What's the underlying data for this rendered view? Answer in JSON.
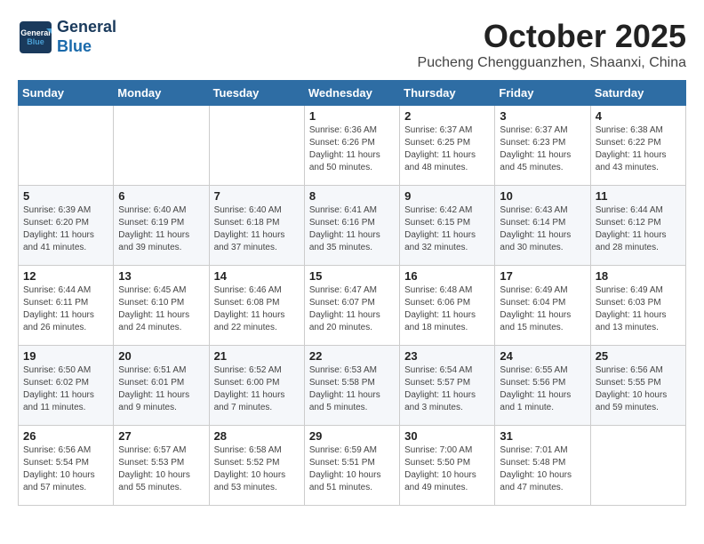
{
  "header": {
    "logo_line1": "General",
    "logo_line2": "Blue",
    "month": "October 2025",
    "location": "Pucheng Chengguanzhen, Shaanxi, China"
  },
  "days_of_week": [
    "Sunday",
    "Monday",
    "Tuesday",
    "Wednesday",
    "Thursday",
    "Friday",
    "Saturday"
  ],
  "weeks": [
    [
      {
        "day": "",
        "info": ""
      },
      {
        "day": "",
        "info": ""
      },
      {
        "day": "",
        "info": ""
      },
      {
        "day": "1",
        "info": "Sunrise: 6:36 AM\nSunset: 6:26 PM\nDaylight: 11 hours\nand 50 minutes."
      },
      {
        "day": "2",
        "info": "Sunrise: 6:37 AM\nSunset: 6:25 PM\nDaylight: 11 hours\nand 48 minutes."
      },
      {
        "day": "3",
        "info": "Sunrise: 6:37 AM\nSunset: 6:23 PM\nDaylight: 11 hours\nand 45 minutes."
      },
      {
        "day": "4",
        "info": "Sunrise: 6:38 AM\nSunset: 6:22 PM\nDaylight: 11 hours\nand 43 minutes."
      }
    ],
    [
      {
        "day": "5",
        "info": "Sunrise: 6:39 AM\nSunset: 6:20 PM\nDaylight: 11 hours\nand 41 minutes."
      },
      {
        "day": "6",
        "info": "Sunrise: 6:40 AM\nSunset: 6:19 PM\nDaylight: 11 hours\nand 39 minutes."
      },
      {
        "day": "7",
        "info": "Sunrise: 6:40 AM\nSunset: 6:18 PM\nDaylight: 11 hours\nand 37 minutes."
      },
      {
        "day": "8",
        "info": "Sunrise: 6:41 AM\nSunset: 6:16 PM\nDaylight: 11 hours\nand 35 minutes."
      },
      {
        "day": "9",
        "info": "Sunrise: 6:42 AM\nSunset: 6:15 PM\nDaylight: 11 hours\nand 32 minutes."
      },
      {
        "day": "10",
        "info": "Sunrise: 6:43 AM\nSunset: 6:14 PM\nDaylight: 11 hours\nand 30 minutes."
      },
      {
        "day": "11",
        "info": "Sunrise: 6:44 AM\nSunset: 6:12 PM\nDaylight: 11 hours\nand 28 minutes."
      }
    ],
    [
      {
        "day": "12",
        "info": "Sunrise: 6:44 AM\nSunset: 6:11 PM\nDaylight: 11 hours\nand 26 minutes."
      },
      {
        "day": "13",
        "info": "Sunrise: 6:45 AM\nSunset: 6:10 PM\nDaylight: 11 hours\nand 24 minutes."
      },
      {
        "day": "14",
        "info": "Sunrise: 6:46 AM\nSunset: 6:08 PM\nDaylight: 11 hours\nand 22 minutes."
      },
      {
        "day": "15",
        "info": "Sunrise: 6:47 AM\nSunset: 6:07 PM\nDaylight: 11 hours\nand 20 minutes."
      },
      {
        "day": "16",
        "info": "Sunrise: 6:48 AM\nSunset: 6:06 PM\nDaylight: 11 hours\nand 18 minutes."
      },
      {
        "day": "17",
        "info": "Sunrise: 6:49 AM\nSunset: 6:04 PM\nDaylight: 11 hours\nand 15 minutes."
      },
      {
        "day": "18",
        "info": "Sunrise: 6:49 AM\nSunset: 6:03 PM\nDaylight: 11 hours\nand 13 minutes."
      }
    ],
    [
      {
        "day": "19",
        "info": "Sunrise: 6:50 AM\nSunset: 6:02 PM\nDaylight: 11 hours\nand 11 minutes."
      },
      {
        "day": "20",
        "info": "Sunrise: 6:51 AM\nSunset: 6:01 PM\nDaylight: 11 hours\nand 9 minutes."
      },
      {
        "day": "21",
        "info": "Sunrise: 6:52 AM\nSunset: 6:00 PM\nDaylight: 11 hours\nand 7 minutes."
      },
      {
        "day": "22",
        "info": "Sunrise: 6:53 AM\nSunset: 5:58 PM\nDaylight: 11 hours\nand 5 minutes."
      },
      {
        "day": "23",
        "info": "Sunrise: 6:54 AM\nSunset: 5:57 PM\nDaylight: 11 hours\nand 3 minutes."
      },
      {
        "day": "24",
        "info": "Sunrise: 6:55 AM\nSunset: 5:56 PM\nDaylight: 11 hours\nand 1 minute."
      },
      {
        "day": "25",
        "info": "Sunrise: 6:56 AM\nSunset: 5:55 PM\nDaylight: 10 hours\nand 59 minutes."
      }
    ],
    [
      {
        "day": "26",
        "info": "Sunrise: 6:56 AM\nSunset: 5:54 PM\nDaylight: 10 hours\nand 57 minutes."
      },
      {
        "day": "27",
        "info": "Sunrise: 6:57 AM\nSunset: 5:53 PM\nDaylight: 10 hours\nand 55 minutes."
      },
      {
        "day": "28",
        "info": "Sunrise: 6:58 AM\nSunset: 5:52 PM\nDaylight: 10 hours\nand 53 minutes."
      },
      {
        "day": "29",
        "info": "Sunrise: 6:59 AM\nSunset: 5:51 PM\nDaylight: 10 hours\nand 51 minutes."
      },
      {
        "day": "30",
        "info": "Sunrise: 7:00 AM\nSunset: 5:50 PM\nDaylight: 10 hours\nand 49 minutes."
      },
      {
        "day": "31",
        "info": "Sunrise: 7:01 AM\nSunset: 5:48 PM\nDaylight: 10 hours\nand 47 minutes."
      },
      {
        "day": "",
        "info": ""
      }
    ]
  ]
}
